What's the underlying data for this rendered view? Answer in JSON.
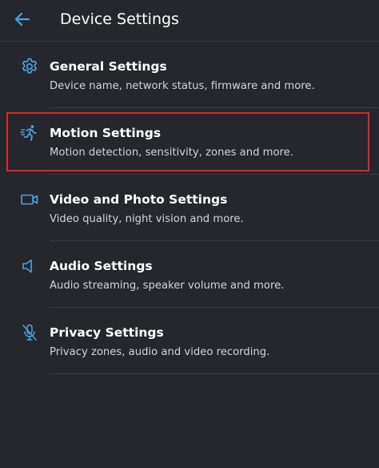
{
  "header": {
    "title": "Device Settings",
    "back_icon": "arrow-left-icon"
  },
  "colors": {
    "background": "#25272c",
    "accent": "#4da3e0",
    "highlight": "#e0252d",
    "primary_text": "#ffffff",
    "secondary_text": "#d2d4d8"
  },
  "settings": [
    {
      "label": "General Settings",
      "description": "Device name, network status, firmware and more.",
      "icon": "gear-icon"
    },
    {
      "label": "Motion Settings",
      "description": "Motion detection, sensitivity, zones and more.",
      "icon": "running-person-icon"
    },
    {
      "label": "Video and Photo Settings",
      "description": "Video quality, night vision and more.",
      "icon": "video-camera-icon"
    },
    {
      "label": "Audio Settings",
      "description": "Audio streaming, speaker volume and more.",
      "icon": "speaker-icon"
    },
    {
      "label": "Privacy Settings",
      "description": "Privacy zones, audio and video recording.",
      "icon": "mic-off-icon"
    }
  ]
}
